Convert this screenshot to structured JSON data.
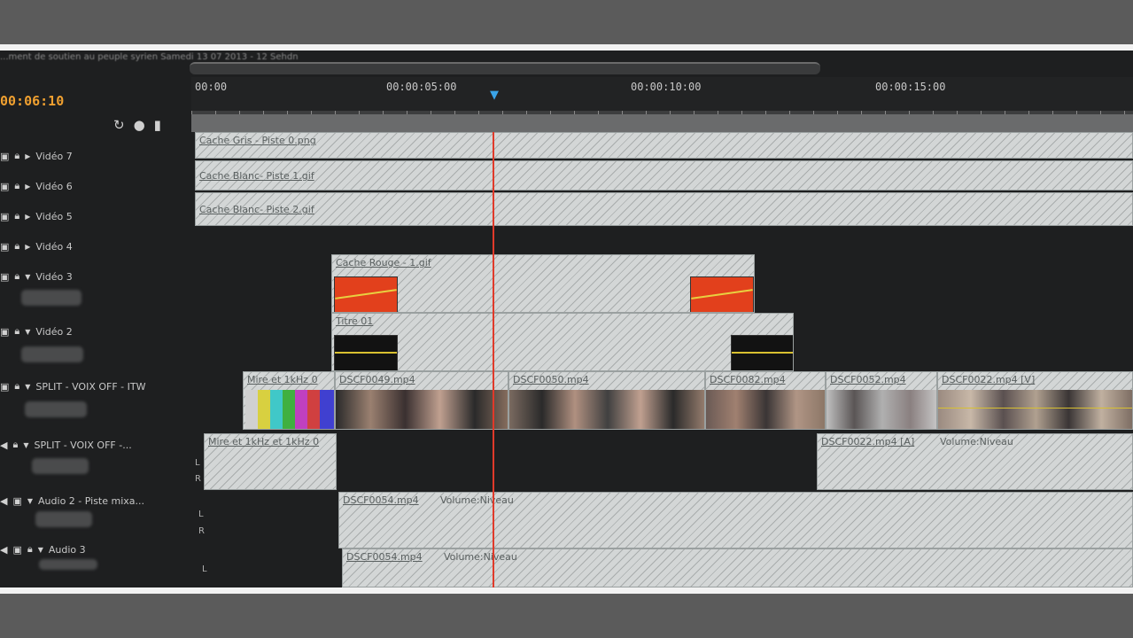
{
  "caption": "...ment de soutien au peuple syrien Samedi 13 07 2013 - 12 Sehdn",
  "timecode": "00:06:10",
  "header_tools": [
    "magnet-icon",
    "marker-icon",
    "lock-icon"
  ],
  "ruler": {
    "labels": [
      "00:00",
      "00:00:05:00",
      "00:00:10:00",
      "00:00:15:00"
    ]
  },
  "colors": {
    "background": "#1e1f20",
    "clip": "#d3d6d6",
    "playhead": "#e03a2a",
    "timecode": "#f0a030",
    "red_thumb": "#e2401c"
  },
  "tracks": [
    {
      "name": "Vidéo 7"
    },
    {
      "name": "Vidéo 6"
    },
    {
      "name": "Vidéo 5"
    },
    {
      "name": "Vidéo 4"
    },
    {
      "name": "Vidéo 3"
    },
    {
      "name": "Vidéo 2"
    },
    {
      "name": "SPLIT - VOIX OFF - ITW"
    },
    {
      "name": "SPLIT - VOIX OFF -..."
    },
    {
      "name": "Audio 2 - Piste mixa..."
    },
    {
      "name": "Audio 3"
    }
  ],
  "clips": {
    "v7": "Cache Gris - Piste 0.png",
    "v6": "Cache Blanc- Piste 1.gif",
    "v5": "Cache Blanc- Piste 2.gif",
    "v3": "Cache Rouge - 1.gif",
    "v2": "Titre 01",
    "split_video": [
      "Mire et 1kHz 0",
      "DSCF0049.mp4",
      "DSCF0050.mp4",
      "DSCF0082.mp4",
      "DSCF0052.mp4",
      "DSCF0022.mp4 [V]"
    ],
    "split_audio": [
      "Mire et 1kHz et 1kHz 0",
      "DSCF0022.mp4 [A]",
      "Volume:Niveau"
    ],
    "audio2": [
      "DSCF0054.mp4",
      "Volume:Niveau"
    ],
    "audio3": [
      "DSCF0054.mp4",
      "Volume:Niveau"
    ]
  },
  "channels": {
    "left": "L",
    "right": "R"
  }
}
